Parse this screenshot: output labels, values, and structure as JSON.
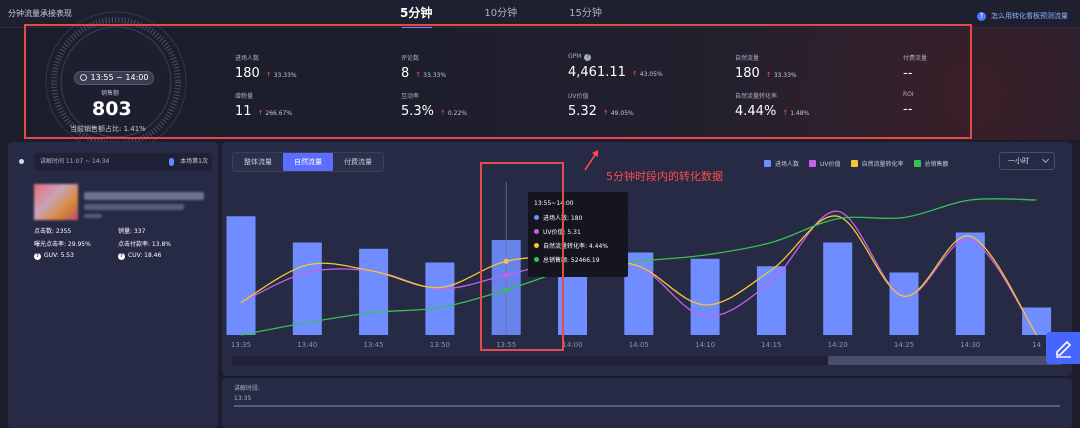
{
  "header": {
    "title": "分钟流量承接表现",
    "tabs": [
      {
        "label": "5分钟",
        "active": true
      },
      {
        "label": "10分钟",
        "active": false
      },
      {
        "label": "15分钟",
        "active": false
      }
    ],
    "help_text": "怎么用转化看板预测流量",
    "help_icon": "question-circle-icon"
  },
  "gauge": {
    "time_range": "13:55 ~ 14:00",
    "label": "销售额",
    "value": "803",
    "ratio_text": "当前销售额占比: 1.41%"
  },
  "metrics": [
    {
      "label": "进场人数",
      "value": "180",
      "change": "33.33%"
    },
    {
      "label": "评论数",
      "value": "8",
      "change": "33.33%"
    },
    {
      "label": "GPM",
      "value": "4,461.11",
      "change": "43.05%",
      "has_help": true
    },
    {
      "label": "自然流量",
      "value": "180",
      "change": "33.33%"
    },
    {
      "label": "付费流量",
      "value": "--",
      "change": ""
    },
    {
      "label": "增粉量",
      "value": "11",
      "change": "266.67%"
    },
    {
      "label": "互动率",
      "value": "5.3%",
      "change": "0.22%"
    },
    {
      "label": "UV价值",
      "value": "5.32",
      "change": "49.05%"
    },
    {
      "label": "自然流量转化率",
      "value": "4.44%",
      "change": "1.48%"
    },
    {
      "label": "ROI",
      "value": "--",
      "change": ""
    }
  ],
  "left_panel": {
    "time_text": "讲解时间 11:07 ~ 14:34",
    "count_text": "本场第1次",
    "mic_icon": "microphone-icon",
    "stats": {
      "clicks": "点击数: 2355",
      "sales": "销量: 337",
      "ctr": "曝光点击率: 29.95%",
      "cvr": "点击付款率: 13.8%",
      "guv": "GUV: 5.53",
      "cuv": "CUV: 18.46"
    }
  },
  "chart_panel": {
    "subtabs": [
      {
        "label": "整体流量",
        "active": false
      },
      {
        "label": "自然流量",
        "active": true
      },
      {
        "label": "付费流量",
        "active": false
      }
    ],
    "range_label": "一小时",
    "annotation_text": "5分钟时段内的转化数据",
    "tooltip": {
      "title": "13:55~14:00",
      "rows": [
        {
          "label": "进场人数: 180",
          "color": "#6f8dff"
        },
        {
          "label": "UV价值: 5.31",
          "color": "#c760e8"
        },
        {
          "label": "自然流量转化率: 4.44%",
          "color": "#f3c735"
        },
        {
          "label": "总销售额: 52466.19",
          "color": "#38c152"
        }
      ]
    }
  },
  "chart_data": {
    "type": "bar",
    "categories": [
      "13:35",
      "13:40",
      "13:45",
      "13:50",
      "13:55",
      "14:00",
      "14:05",
      "14:10",
      "14:15",
      "14:20",
      "14:25",
      "14:30",
      "14:35"
    ],
    "tick_labels": [
      "13:35",
      "13:40",
      "13:45",
      "13:50",
      "13:55",
      "14:00",
      "14:05",
      "14:10",
      "14:15",
      "14:20",
      "14:25",
      "14:30",
      "14"
    ],
    "series": [
      {
        "name": "进场人数",
        "type": "bar",
        "color": "#6f8dff",
        "values": [
          0.95,
          0.74,
          0.69,
          0.58,
          0.76,
          0.56,
          0.66,
          0.61,
          0.55,
          0.74,
          0.5,
          0.82,
          0.22
        ]
      },
      {
        "name": "UV价值",
        "type": "line",
        "color": "#c760e8",
        "values": [
          0.26,
          0.5,
          0.51,
          0.37,
          0.48,
          0.6,
          0.55,
          0.15,
          0.43,
          0.99,
          0.31,
          0.76,
          0.0
        ]
      },
      {
        "name": "自然流量转化率",
        "type": "line",
        "color": "#f3c735",
        "values": [
          0.26,
          0.56,
          0.51,
          0.38,
          0.59,
          0.62,
          0.55,
          0.24,
          0.52,
          0.95,
          0.31,
          0.79,
          0.0
        ]
      },
      {
        "name": "总销售额",
        "type": "line",
        "color": "#38c152",
        "values": [
          0.0,
          0.1,
          0.18,
          0.22,
          0.36,
          0.53,
          0.59,
          0.64,
          0.74,
          0.93,
          0.94,
          1.08,
          1.08
        ]
      }
    ],
    "legend_position": "top-right",
    "grid": true
  }
}
